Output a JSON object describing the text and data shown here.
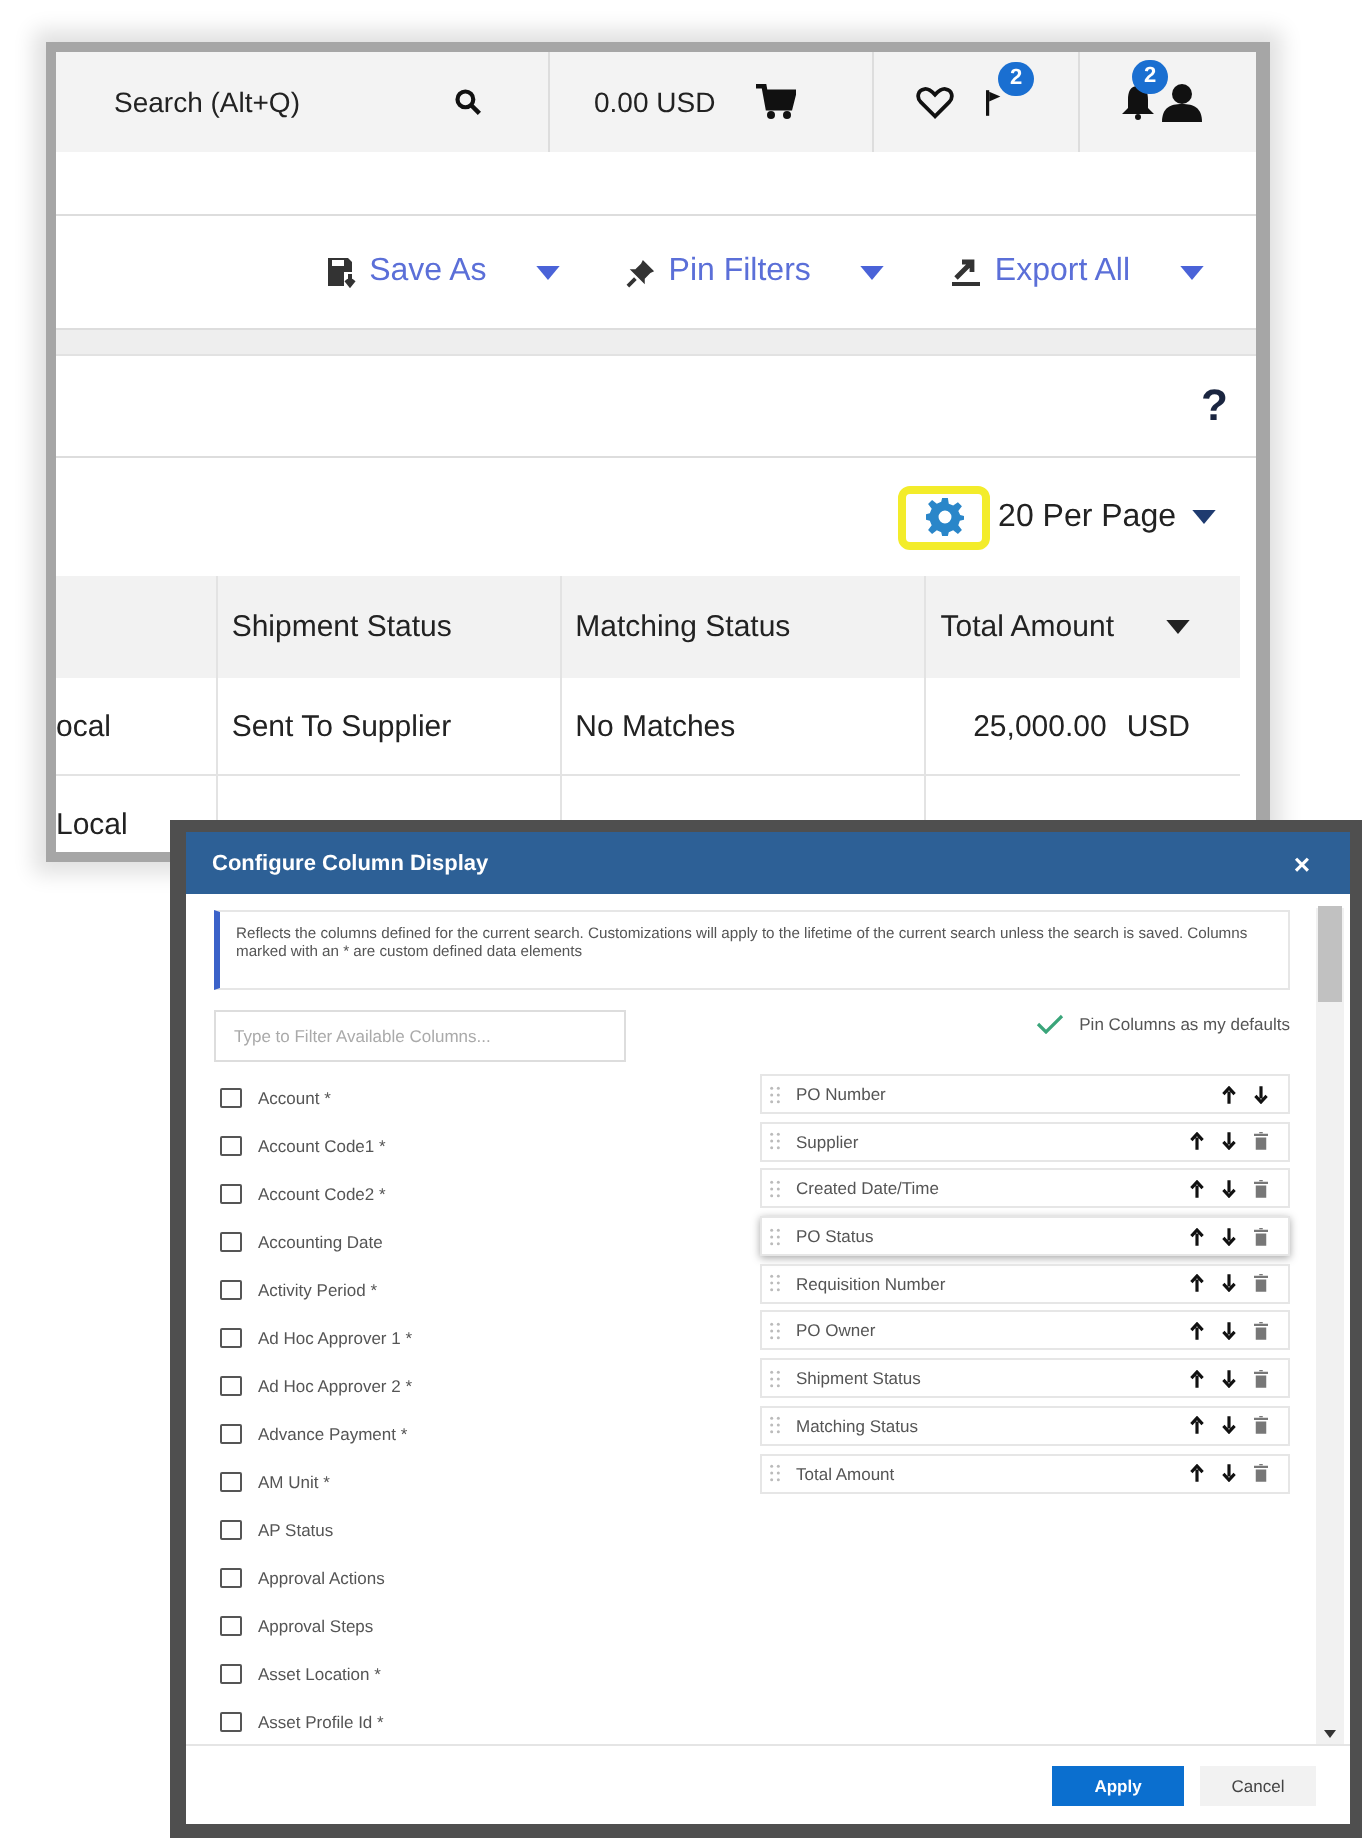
{
  "top_bar": {
    "search": {
      "placeholder": "Search (Alt+Q)"
    },
    "cart_total": "0.00 USD",
    "flag_badge": "2",
    "notification_badge": "2"
  },
  "toolbar": {
    "actions": [
      {
        "label": "Save As",
        "kind": "save"
      },
      {
        "label": "Pin Filters",
        "kind": "pin"
      },
      {
        "label": "Export All",
        "kind": "export"
      }
    ]
  },
  "help": "?",
  "pagination": {
    "per_page": "20 Per Page"
  },
  "table": {
    "columns": [
      "Shipment Status",
      "Matching Status",
      "Total Amount"
    ],
    "rows": [
      {
        "column_1": "ocal",
        "shipment_status": "Sent To Supplier",
        "matching_status": "No Matches",
        "amount": "25,000.00",
        "currency": "USD"
      },
      {
        "column_1": "Local"
      }
    ]
  },
  "modal": {
    "title": "Configure Column Display",
    "close": "×",
    "info": "Reflects the columns defined for the current search. Customizations will apply to the lifetime of the current search unless the search is saved. Columns marked with an * are custom defined data elements",
    "filter": {
      "placeholder": "Type to Filter Available Columns..."
    },
    "pin_defaults": {
      "label": "Pin Columns as my defaults",
      "checked": true
    },
    "available_columns": [
      {
        "label": "Account *",
        "checked": false
      },
      {
        "label": "Account Code1 *",
        "checked": false
      },
      {
        "label": "Account Code2 *",
        "checked": false
      },
      {
        "label": "Accounting Date",
        "checked": false
      },
      {
        "label": "Activity Period *",
        "checked": false
      },
      {
        "label": "Ad Hoc Approver 1 *",
        "checked": false
      },
      {
        "label": "Ad Hoc Approver 2 *",
        "checked": false
      },
      {
        "label": "Advance Payment *",
        "checked": false
      },
      {
        "label": "AM Unit *",
        "checked": false
      },
      {
        "label": "AP Status",
        "checked": false
      },
      {
        "label": "Approval Actions",
        "checked": false
      },
      {
        "label": "Approval Steps",
        "checked": false
      },
      {
        "label": "Asset Location *",
        "checked": false
      },
      {
        "label": "Asset Profile Id *",
        "checked": false
      }
    ],
    "selected_columns": [
      {
        "label": "PO Number",
        "removable": false,
        "selected": false
      },
      {
        "label": "Supplier",
        "removable": true,
        "selected": false
      },
      {
        "label": "Created Date/Time",
        "removable": true,
        "selected": false
      },
      {
        "label": "PO Status",
        "removable": true,
        "selected": true
      },
      {
        "label": "Requisition Number",
        "removable": true,
        "selected": false
      },
      {
        "label": "PO Owner",
        "removable": true,
        "selected": false
      },
      {
        "label": "Shipment Status",
        "removable": true,
        "selected": false
      },
      {
        "label": "Matching Status",
        "removable": true,
        "selected": false
      },
      {
        "label": "Total Amount",
        "removable": true,
        "selected": false
      }
    ],
    "buttons": [
      {
        "label": "Apply",
        "kind": "primary"
      },
      {
        "label": "Cancel",
        "kind": "secondary"
      }
    ]
  }
}
